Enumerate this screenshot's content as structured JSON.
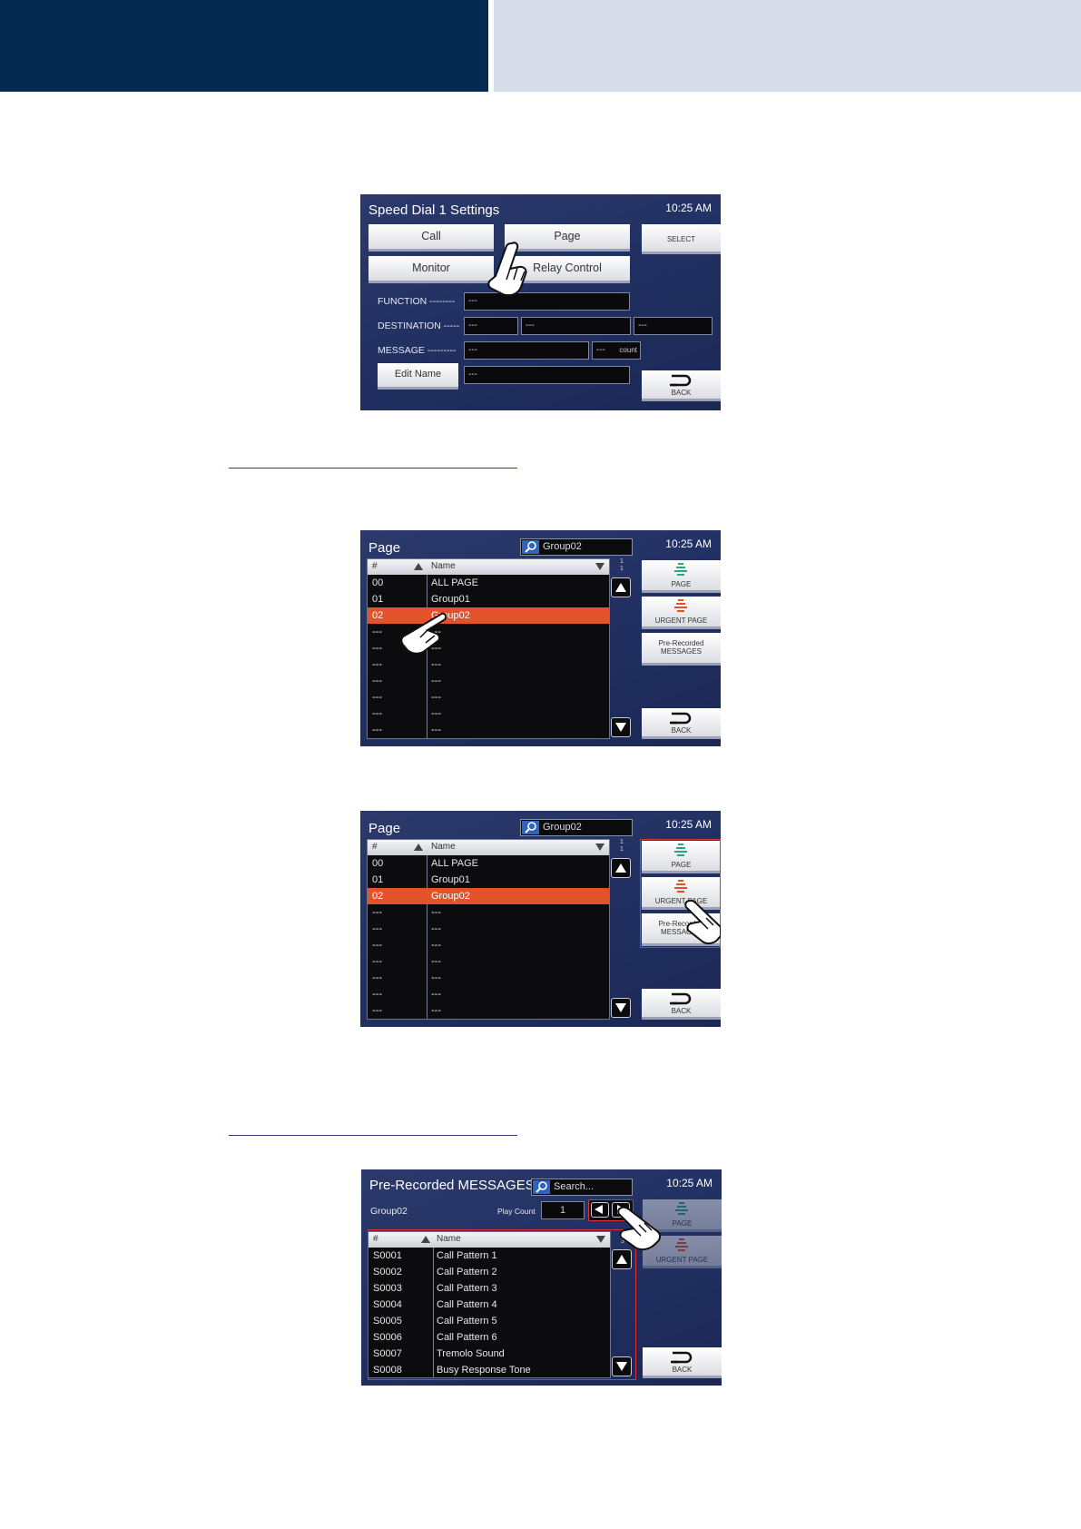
{
  "screen1": {
    "title": "Speed Dial 1 Settings",
    "time": "10:25 AM",
    "buttons": {
      "call": "Call",
      "page": "Page",
      "monitor": "Monitor",
      "relay": "Relay Control",
      "select": "SELECT",
      "edit_name": "Edit Name",
      "back": "BACK"
    },
    "labels": {
      "function": "FUNCTION --------",
      "destination": "DESTINATION -----",
      "message": "MESSAGE ---------"
    },
    "fields": {
      "function": "---",
      "dest1": "---",
      "dest2": "---",
      "dest3": "---",
      "message": "---",
      "count_value": "---",
      "count_unit": "count",
      "name": "---"
    }
  },
  "screen2": {
    "title": "Page",
    "time": "10:25 AM",
    "search": "Group02",
    "columns": {
      "num": "#",
      "name": "Name"
    },
    "pager": {
      "current": "1",
      "total": "1"
    },
    "rows": [
      {
        "num": "00",
        "name": "ALL PAGE"
      },
      {
        "num": "01",
        "name": "Group01"
      },
      {
        "num": "02",
        "name": "Group02"
      },
      {
        "num": "---",
        "name": "---"
      },
      {
        "num": "---",
        "name": "---"
      },
      {
        "num": "---",
        "name": "---"
      },
      {
        "num": "---",
        "name": "---"
      },
      {
        "num": "---",
        "name": "---"
      },
      {
        "num": "---",
        "name": "---"
      },
      {
        "num": "---",
        "name": "---"
      }
    ],
    "side": {
      "page": "PAGE",
      "urgent": "URGENT PAGE",
      "prerec1": "Pre-Recorded",
      "prerec2": "MESSAGES",
      "back": "BACK"
    }
  },
  "screen3": {
    "title": "Page",
    "time": "10:25 AM",
    "search": "Group02",
    "columns": {
      "num": "#",
      "name": "Name"
    },
    "pager": {
      "current": "1",
      "total": "1"
    },
    "rows": [
      {
        "num": "00",
        "name": "ALL PAGE"
      },
      {
        "num": "01",
        "name": "Group01"
      },
      {
        "num": "02",
        "name": "Group02"
      },
      {
        "num": "---",
        "name": "---"
      },
      {
        "num": "---",
        "name": "---"
      },
      {
        "num": "---",
        "name": "---"
      },
      {
        "num": "---",
        "name": "---"
      },
      {
        "num": "---",
        "name": "---"
      },
      {
        "num": "---",
        "name": "---"
      },
      {
        "num": "---",
        "name": "---"
      }
    ],
    "side": {
      "page": "PAGE",
      "urgent": "URGENT PAGE",
      "prerec1": "Pre-Recorded",
      "prerec2": "MESSAGES",
      "back": "BACK"
    }
  },
  "screen4": {
    "title": "Pre-Recorded MESSAGES",
    "time": "10:25 AM",
    "search_placeholder": "Search...",
    "group": "Group02",
    "play_count_label": "Play Count",
    "play_count": "1",
    "columns": {
      "num": "#",
      "name": "Name"
    },
    "pager": {
      "current": "1",
      "total": "3"
    },
    "rows": [
      {
        "num": "S0001",
        "name": "Call Pattern 1"
      },
      {
        "num": "S0002",
        "name": "Call Pattern 2"
      },
      {
        "num": "S0003",
        "name": "Call Pattern 3"
      },
      {
        "num": "S0004",
        "name": "Call Pattern 4"
      },
      {
        "num": "S0005",
        "name": "Call Pattern 5"
      },
      {
        "num": "S0006",
        "name": "Call Pattern 6"
      },
      {
        "num": "S0007",
        "name": "Tremolo Sound"
      },
      {
        "num": "S0008",
        "name": "Busy Response Tone"
      }
    ],
    "side": {
      "page": "PAGE",
      "urgent": "URGENT PAGE",
      "back": "BACK"
    }
  },
  "icons": {
    "hand": "pointing-hand-icon",
    "search": "search-icon",
    "back": "back-arrow-icon",
    "page": "page-speaker-icon",
    "urgent": "urgent-speaker-icon"
  },
  "colors": {
    "header_dark": "#052a4f",
    "header_light": "#d6dcea",
    "selected_row": "#e3522a",
    "highlight": "#e0303a",
    "page_icon": "#2fa37e",
    "urgent_icon": "#e0502a"
  }
}
